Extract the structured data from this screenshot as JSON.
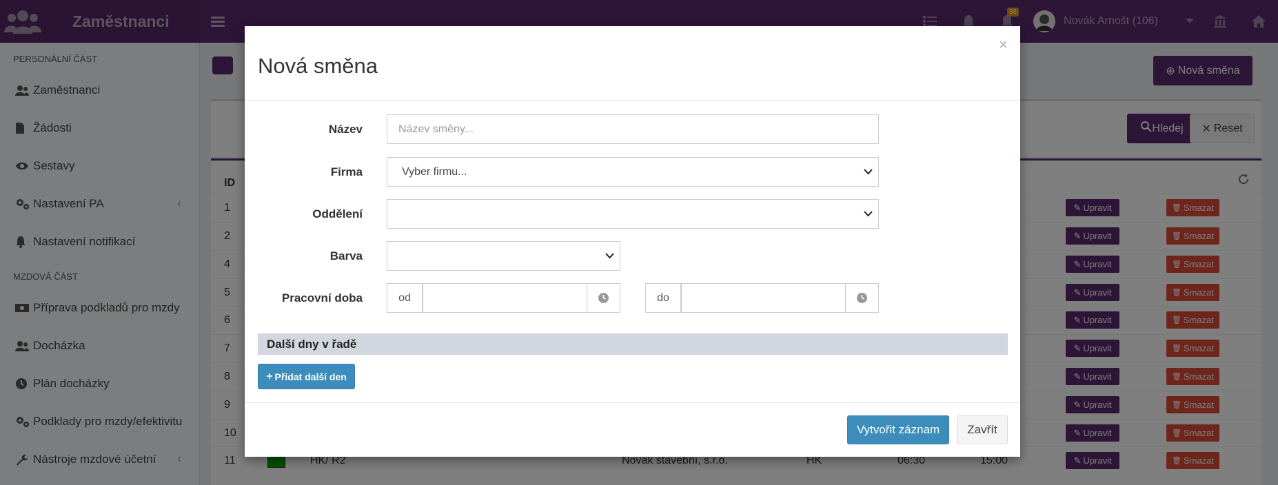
{
  "app": {
    "title": "Zaměstnanci",
    "notification_count": "38",
    "user_name": "Novák Arnošt (106)"
  },
  "sidebar": {
    "section1": "PERSONÁLNÍ ČÁST",
    "items1": [
      "Zaměstnanci",
      "Žádosti",
      "Sestavy",
      "Nastavení PA",
      "Nastavení notifikací"
    ],
    "section2": "MZDOVÁ ČÁST",
    "items2": [
      "Příprava podkladů pro mzdy",
      "Docházka",
      "Plán docházky",
      "Podklady pro mzdy/efektivitu",
      "Nástroje mzdové účetní"
    ]
  },
  "page": {
    "new_shift_button": "Nová směna",
    "search_button": "Hledej",
    "reset_button": "Reset",
    "id_header": "ID"
  },
  "table": {
    "edit_label": "Upravit",
    "delete_label": "Smazat",
    "rows": [
      {
        "id": "1",
        "name": "",
        "company": "",
        "dept": "",
        "from": "",
        "to": ""
      },
      {
        "id": "2",
        "name": "",
        "company": "",
        "dept": "",
        "from": "",
        "to": ""
      },
      {
        "id": "4",
        "name": "",
        "company": "",
        "dept": "",
        "from": "",
        "to": ""
      },
      {
        "id": "5",
        "name": "",
        "company": "",
        "dept": "",
        "from": "",
        "to": ""
      },
      {
        "id": "6",
        "name": "",
        "company": "",
        "dept": "",
        "from": "",
        "to": ""
      },
      {
        "id": "7",
        "name": "",
        "company": "",
        "dept": "",
        "from": "",
        "to": ""
      },
      {
        "id": "8",
        "name": "",
        "company": "",
        "dept": "",
        "from": "",
        "to": ""
      },
      {
        "id": "9",
        "name": "",
        "company": "",
        "dept": "",
        "from": "",
        "to": ""
      },
      {
        "id": "10",
        "name": "",
        "company": "",
        "dept": "",
        "from": "",
        "to": ""
      },
      {
        "id": "11",
        "name": "HK/ R2",
        "company": "Novák stavební, s.r.o.",
        "dept": "HK",
        "from": "06:30",
        "to": "15:00",
        "color": "#00a000"
      }
    ]
  },
  "modal": {
    "title": "Nová směna",
    "close_symbol": "×",
    "name_label": "Název",
    "name_placeholder": "Název směny...",
    "company_label": "Firma",
    "company_value": "Vyber firmu...",
    "dept_label": "Oddělení",
    "dept_value": "",
    "color_label": "Barva",
    "color_value": "",
    "workhours_label": "Pracovní doba",
    "from_addon": "od",
    "to_addon": "do",
    "next_days_section": "Další dny v řadě",
    "add_day_button": "Přidat další den",
    "create_button": "Vytvořit záznam",
    "close_button": "Zavřít"
  }
}
